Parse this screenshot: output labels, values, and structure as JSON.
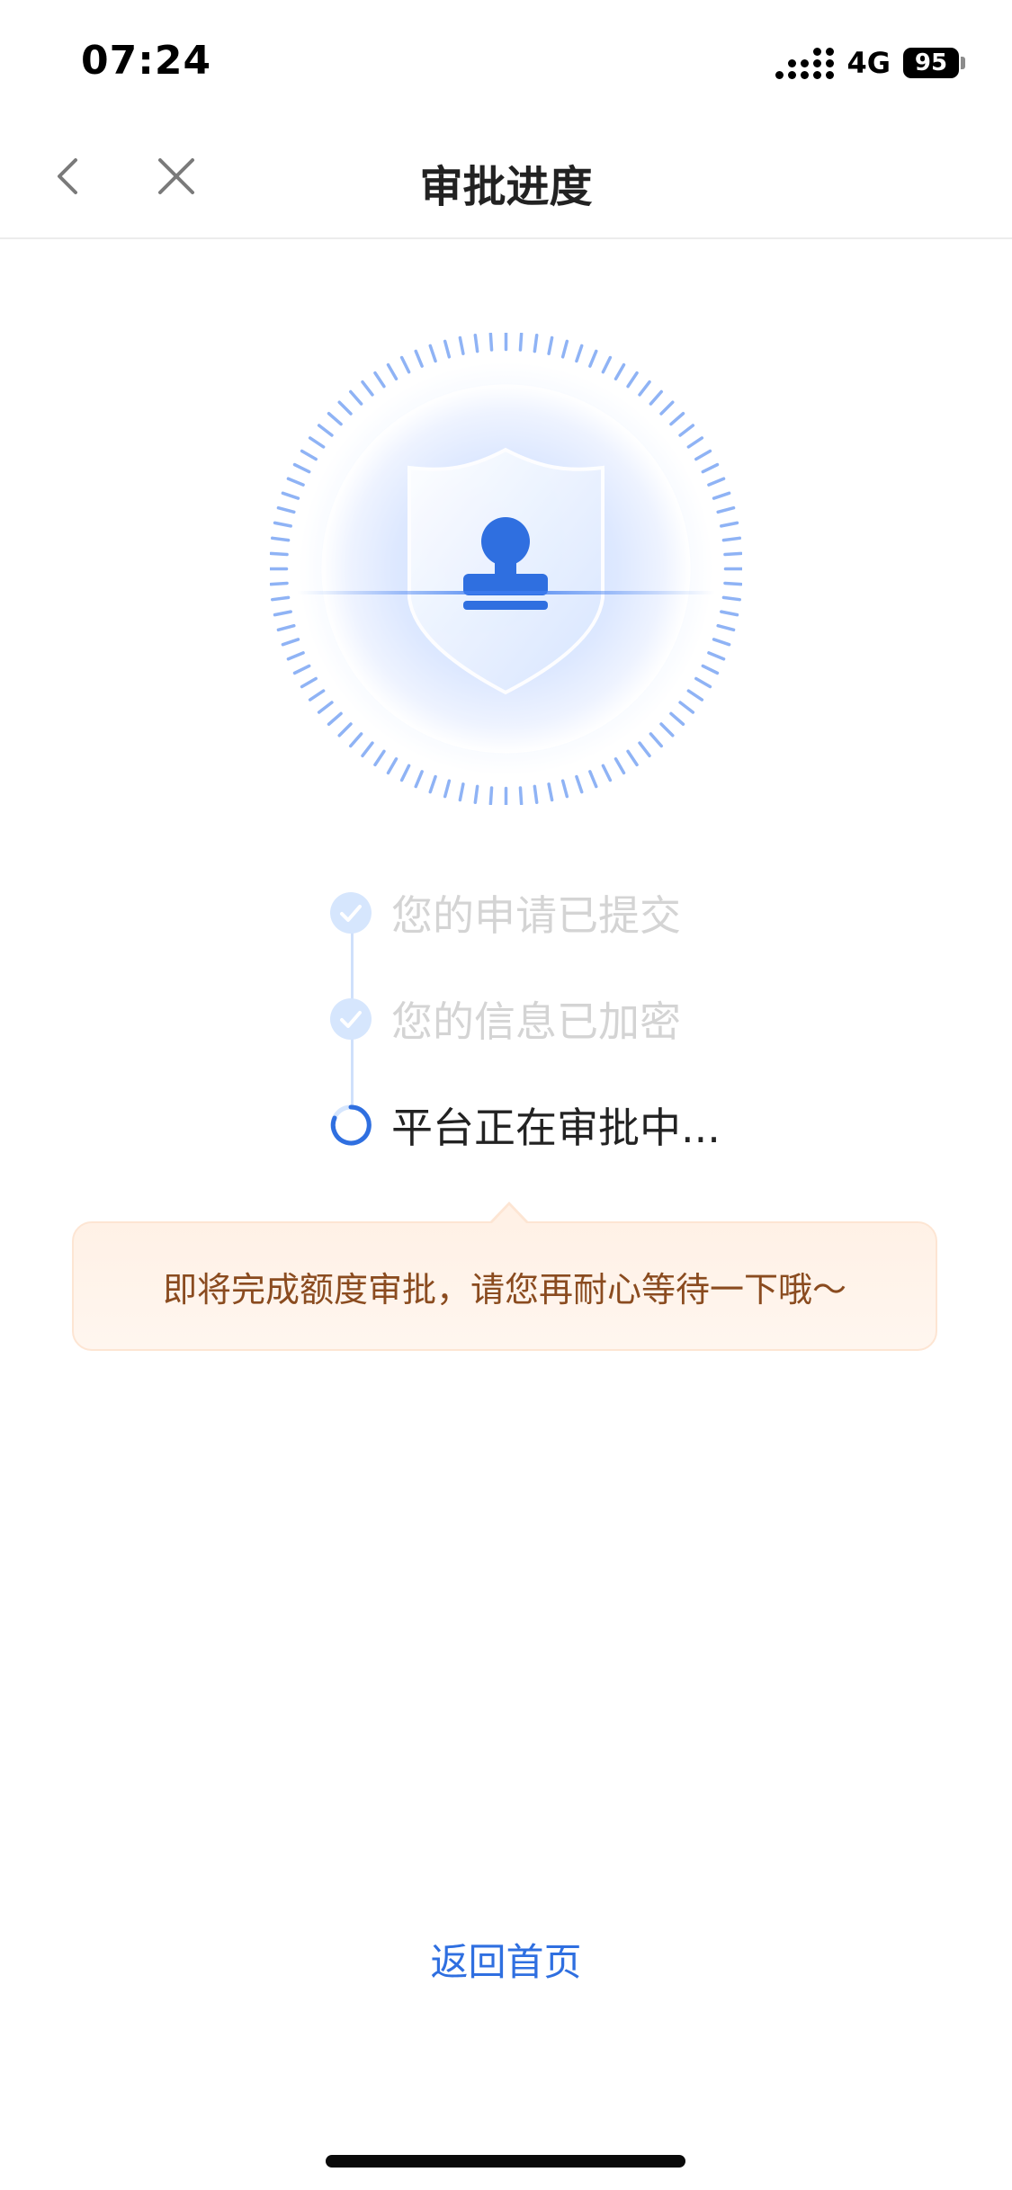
{
  "status_bar": {
    "time": "07:24",
    "network": "4G",
    "battery": "95"
  },
  "nav": {
    "title": "审批进度",
    "back_icon": "chevron-left-icon",
    "close_icon": "close-icon"
  },
  "hero": {
    "icon": "shield-stamp-icon",
    "accent_color": "#2f6fe0"
  },
  "steps": [
    {
      "label": "您的申请已提交",
      "status": "done"
    },
    {
      "label": "您的信息已加密",
      "status": "done"
    },
    {
      "label": "平台正在审批中...",
      "status": "in-progress"
    }
  ],
  "tip": {
    "text": "即将完成额度审批，请您再耐心等待一下哦～"
  },
  "footer": {
    "home_link": "返回首页"
  },
  "colors": {
    "accent": "#2f6fe0",
    "tip_text": "#8a4b1f",
    "tip_bg": "#fff1e6",
    "done_text": "#d4d4d4"
  }
}
